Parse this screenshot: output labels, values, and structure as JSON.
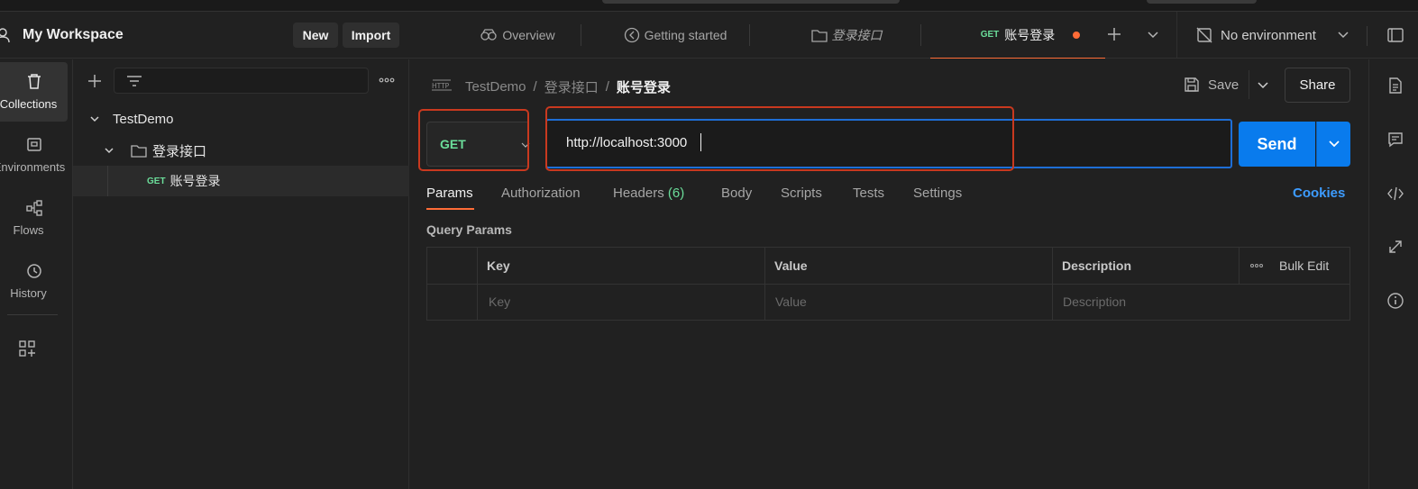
{
  "workspace": {
    "title": "My Workspace",
    "new_label": "New",
    "import_label": "Import"
  },
  "rail": {
    "items": [
      {
        "label": "Collections",
        "icon": "trash-icon"
      },
      {
        "label": "Environments",
        "icon": "environment-icon"
      },
      {
        "label": "Flows",
        "icon": "flows-icon"
      },
      {
        "label": "History",
        "icon": "history-icon"
      }
    ]
  },
  "sidebar": {
    "tree": {
      "collection": "TestDemo",
      "folder": "登录接口",
      "request_method": "GET",
      "request_name": "账号登录"
    }
  },
  "tabs": [
    {
      "label": "Overview"
    },
    {
      "label": "Getting started"
    },
    {
      "label": "登录接口"
    },
    {
      "method": "GET",
      "label": "账号登录",
      "active": true
    }
  ],
  "environment": {
    "label": "No environment"
  },
  "breadcrumb": {
    "collection": "TestDemo",
    "sep": "/",
    "folder": "登录接口",
    "current": "账号登录"
  },
  "toolbar": {
    "save_label": "Save",
    "share_label": "Share"
  },
  "request": {
    "method": "GET",
    "url": "http://localhost:3000",
    "send_label": "Send"
  },
  "request_tabs": {
    "params": "Params",
    "authorization": "Authorization",
    "headers": "Headers",
    "headers_count": "(6)",
    "body": "Body",
    "scripts": "Scripts",
    "tests": "Tests",
    "settings": "Settings",
    "cookies": "Cookies"
  },
  "query_params": {
    "title": "Query Params",
    "headers": {
      "key": "Key",
      "value": "Value",
      "description": "Description",
      "bulk_edit": "Bulk Edit"
    },
    "placeholders": {
      "key": "Key",
      "value": "Value",
      "description": "Description"
    }
  },
  "colors": {
    "accent": "#ff6c37",
    "send": "#097bed",
    "get_method": "#6bdd9a",
    "annotation": "#c9391f",
    "url_focus": "#1e6ed6"
  }
}
